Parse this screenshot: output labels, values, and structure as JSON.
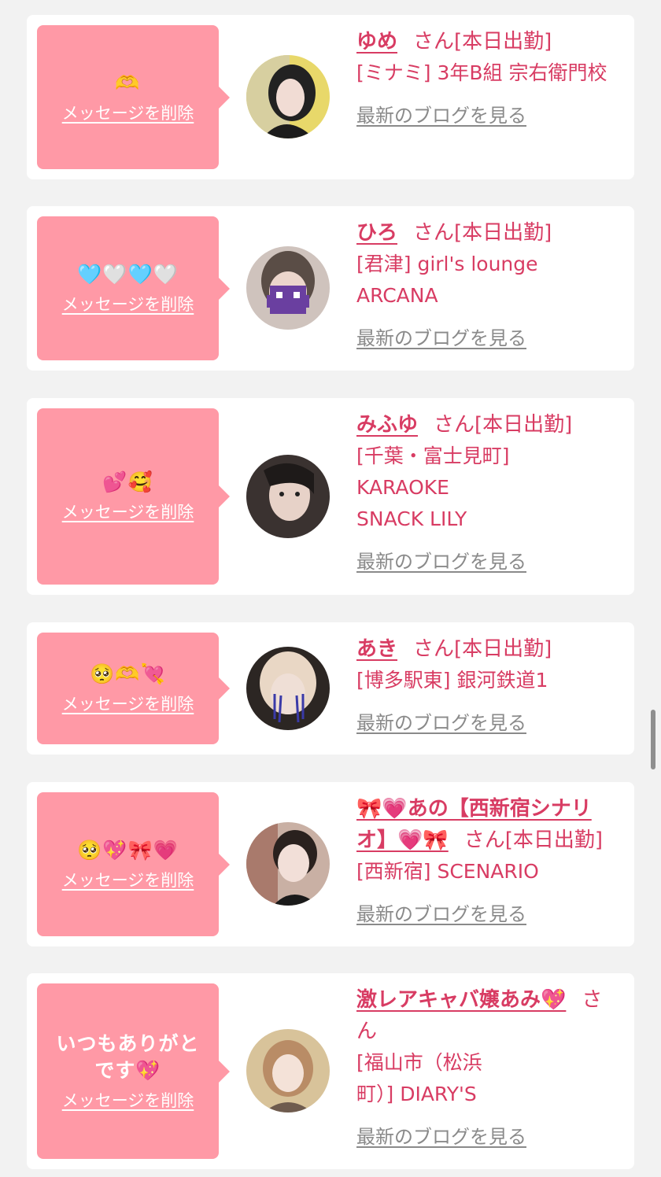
{
  "delete_label": "メッセージを削除",
  "blog_label": "最新のブログを見る",
  "san_label": "さん",
  "status_label": "[本日出勤]",
  "colors": {
    "accent": "#d83c63",
    "message_bg": "#ff99a6",
    "page_bg": "#f2f2f2"
  },
  "cards": [
    {
      "message": "🫶",
      "name": "ゆめ",
      "shop": "[ミナミ] 3年B組 宗右衛門校"
    },
    {
      "message": "🩵🤍🩵🤍",
      "name": "ひろ",
      "shop": "[君津] girl's lounge ARCANA"
    },
    {
      "message": "💕🥰",
      "name": "みふゆ",
      "shop": "[千葉・富士見町] KARAOKE SNACK LILY"
    },
    {
      "message": "🥺🫶💘",
      "name": "あき",
      "shop": "[博多駅東] 銀河鉄道1"
    },
    {
      "message": "🥺💖🎀💗",
      "name": "🎀💗あの【西新宿シナリオ】💗🎀",
      "shop": "[西新宿] SCENARIO"
    },
    {
      "message": "いつもありがとです💖",
      "name": "激レアキャバ嬢あみ💖",
      "shop": "[福山市（松浜町）] DIARY'S"
    }
  ]
}
